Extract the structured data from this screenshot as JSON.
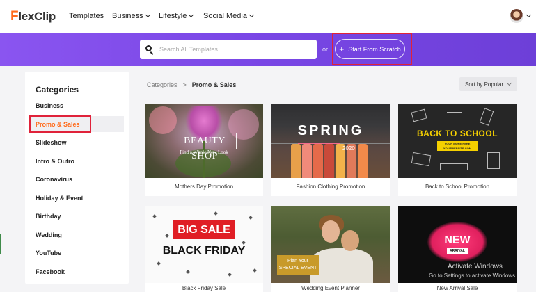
{
  "app": {
    "logo_text": "lexClip",
    "logo_mark": "F"
  },
  "nav": {
    "items": [
      {
        "label": "Templates",
        "dropdown": false
      },
      {
        "label": "Business",
        "dropdown": true
      },
      {
        "label": "Lifestyle",
        "dropdown": true
      },
      {
        "label": "Social Media",
        "dropdown": true
      }
    ]
  },
  "search": {
    "placeholder": "Search All Templates",
    "or_text": "or",
    "start_label": "Start From Scratch",
    "start_icon": "plus-icon"
  },
  "sidebar": {
    "title": "Categories",
    "items": [
      {
        "label": "Business"
      },
      {
        "label": "Promo & Sales",
        "active": true
      },
      {
        "label": "Slideshow"
      },
      {
        "label": "Intro & Outro"
      },
      {
        "label": "Coronavirus"
      },
      {
        "label": "Holiday & Event"
      },
      {
        "label": "Birthday"
      },
      {
        "label": "Wedding"
      },
      {
        "label": "YouTube"
      },
      {
        "label": "Facebook"
      }
    ]
  },
  "breadcrumb": {
    "root": "Categories",
    "sep": ">",
    "current": "Promo & Sales"
  },
  "sort": {
    "label": "Sort by Popular"
  },
  "cards": [
    {
      "caption": "Mothers Day Promotion",
      "title": "BEAUTY SHOP",
      "sub": "Find a Whole New Look"
    },
    {
      "caption": "Fashion Clothing Promotion",
      "title": "SPRING",
      "sub": "2020"
    },
    {
      "caption": "Back to School Promotion",
      "title": "BACK TO SCHOOL",
      "sub": "YOUR MORE HERE\nYOURWEBSITE.COM"
    },
    {
      "caption": "Black Friday Sale",
      "title": "BIG SALE",
      "sub": "BLACK FRIDAY"
    },
    {
      "caption": "Wedding Event Planner",
      "title": "Plan Your",
      "sub": "SPECIAL EVENT"
    },
    {
      "caption": "New Arrival Sale",
      "title": "NEW",
      "sub": "ARRIVAL"
    }
  ],
  "watermark": {
    "title": "Activate Windows",
    "sub": "Go to Settings to activate Windows."
  },
  "colors": {
    "accent": "#ff6a1a",
    "banner": "#7a47e6",
    "highlight": "#e0223a"
  }
}
